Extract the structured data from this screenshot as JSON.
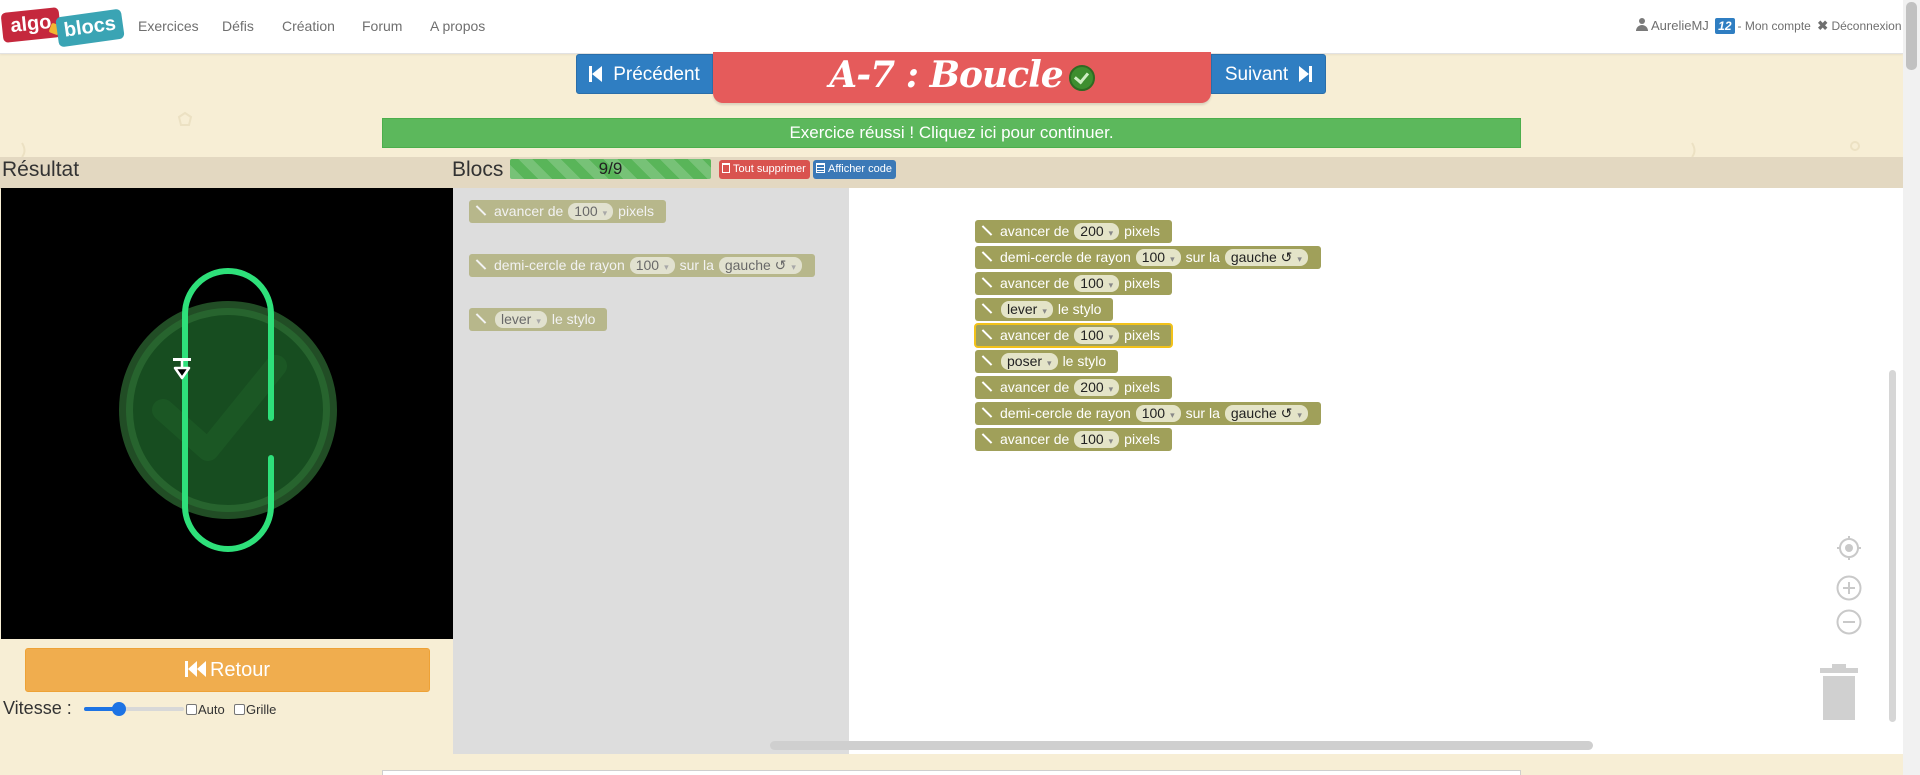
{
  "app": {
    "logo_left": "algo",
    "logo_right": "blocs"
  },
  "nav": {
    "items": [
      {
        "label": "Exercices"
      },
      {
        "label": "Défis"
      },
      {
        "label": "Création"
      },
      {
        "label": "Forum"
      },
      {
        "label": "A propos"
      }
    ],
    "user": {
      "name": "AurelieMJ",
      "badge": "12",
      "account": "- Mon compte",
      "logout": "Déconnexion"
    }
  },
  "exercise": {
    "title": "A-7 : Boucle",
    "prev_label": "Précédent",
    "next_label": "Suivant",
    "success_message": "Exercice réussi ! Cliquez ici pour continuer."
  },
  "result": {
    "title": "Résultat",
    "back_label": "Retour",
    "speed_label": "Vitesse :",
    "speed_value": 0.35,
    "auto_label": "Auto",
    "grid_label": "Grille"
  },
  "blocs": {
    "title": "Blocs",
    "progress_text": "9/9",
    "progress_value": 1.0,
    "clear_label": "Tout supprimer",
    "show_code_label": "Afficher code"
  },
  "toolbox": {
    "b1": {
      "pre": "avancer de",
      "val": "100",
      "post": "pixels"
    },
    "b2": {
      "pre": "demi-cercle de rayon",
      "val": "100",
      "mid": "sur la",
      "dir": "gauche ↺"
    },
    "b3": {
      "val": "lever",
      "post": "le stylo"
    }
  },
  "workspace": {
    "s1": {
      "pre": "avancer de",
      "val": "200",
      "post": "pixels"
    },
    "s2": {
      "pre": "demi-cercle de rayon",
      "val": "100",
      "mid": "sur la",
      "dir": "gauche ↺"
    },
    "s3": {
      "pre": "avancer de",
      "val": "100",
      "post": "pixels"
    },
    "s4": {
      "val": "lever",
      "post": "le stylo"
    },
    "s5": {
      "pre": "avancer de",
      "val": "100",
      "post": "pixels"
    },
    "s6": {
      "val": "poser",
      "post": "le stylo"
    },
    "s7": {
      "pre": "avancer de",
      "val": "200",
      "post": "pixels"
    },
    "s8": {
      "pre": "demi-cercle de rayon",
      "val": "100",
      "mid": "sur la",
      "dir": "gauche ↺"
    },
    "s9": {
      "pre": "avancer de",
      "val": "100",
      "post": "pixels"
    }
  },
  "colors": {
    "accent_blue": "#2f7ec2",
    "title_red": "#e55b5b",
    "success_green": "#5cb85c",
    "block_olive": "#a0a05a",
    "retour_orange": "#f0ad4e",
    "drawing_green": "#2ee07a"
  },
  "icons": [
    "user-icon",
    "skip-back-icon",
    "skip-forward-icon",
    "check-circle-icon",
    "trash-icon",
    "list-icon",
    "fast-backward-icon",
    "pencil-icon",
    "recenter-icon",
    "zoom-in-icon",
    "zoom-out-icon",
    "trash-can-icon",
    "arrow-down-icon"
  ]
}
